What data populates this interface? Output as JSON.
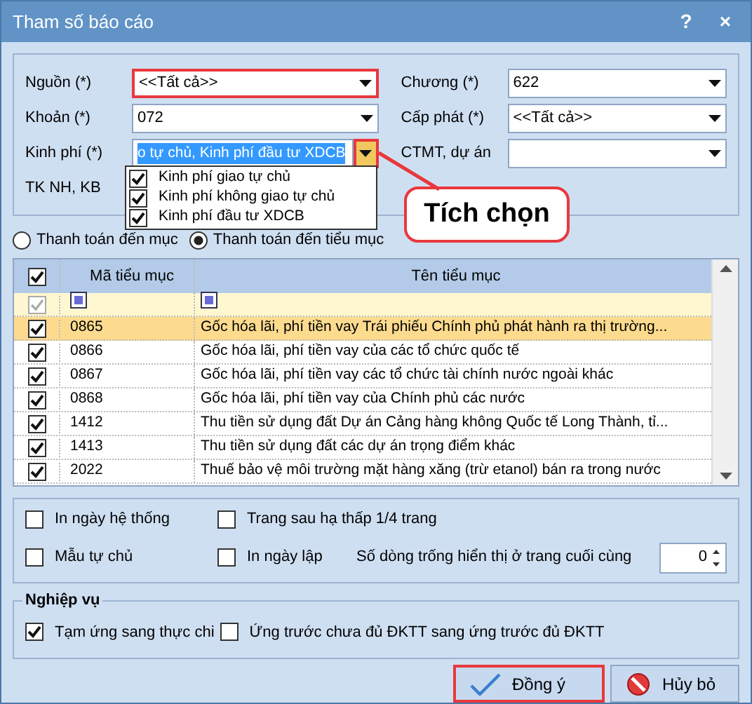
{
  "window": {
    "title": "Tham số báo cáo",
    "help": "?",
    "close": "×"
  },
  "fields": [
    {
      "label": "Nguồn (*)",
      "value": "<<Tất cả>>",
      "annotated": true
    },
    {
      "label": "Chương (*)",
      "value": "622",
      "annotated": false
    },
    {
      "label": "Khoản (*)",
      "value": "072",
      "annotated": false
    },
    {
      "label": "Cấp phát (*)",
      "value": "<<Tất cả>>",
      "annotated": false
    },
    {
      "label": "Kinh phí (*)",
      "value": "o tự chủ, Kinh phí đầu tư XDCB",
      "annotated": false,
      "text_selected": true,
      "dropdown_open": true
    },
    {
      "label": "CTMT, dự án",
      "annotated": false
    }
  ],
  "bank_label": "TK NH, KB",
  "dropdown": {
    "items": [
      {
        "label": "Kinh phí giao tự chủ",
        "checked": true
      },
      {
        "label": "Kinh phí không giao tự chủ",
        "checked": true
      },
      {
        "label": "Kinh phí đầu tư XDCB",
        "checked": true
      }
    ]
  },
  "callout": {
    "text": "Tích chọn"
  },
  "payment_radios": [
    {
      "label": "Thanh toán đến mục",
      "selected": false
    },
    {
      "label": "Thanh toán đến tiểu mục",
      "selected": true
    }
  ],
  "table": {
    "header_checked": true,
    "filter_checked": true,
    "columns": [
      "Mã tiểu mục",
      "Tên tiểu mục"
    ],
    "rows": [
      {
        "code": "0865",
        "name": "Gốc hóa lãi, phí tiền vay Trái phiếu Chính phủ phát hành ra thị trường...",
        "checked": true,
        "selected": true
      },
      {
        "code": "0866",
        "name": "Gốc hóa lãi, phí tiền vay của các tổ chức quốc tế",
        "checked": true,
        "selected": false
      },
      {
        "code": "0867",
        "name": "Gốc hóa lãi, phí tiền vay các tổ chức tài chính nước ngoài khác",
        "checked": true,
        "selected": false
      },
      {
        "code": "0868",
        "name": "Gốc hóa lãi, phí tiền vay của Chính phủ các nước",
        "checked": true,
        "selected": false
      },
      {
        "code": "1412",
        "name": "Thu tiền sử dụng đất Dự án Cảng hàng không Quốc tế Long Thành, tỉ...",
        "checked": true,
        "selected": false
      },
      {
        "code": "1413",
        "name": "Thu tiền sử dụng đất các dự án trọng điểm khác",
        "checked": true,
        "selected": false
      },
      {
        "code": "2022",
        "name": "Thuế bảo vệ môi trường mặt hàng xăng (trừ etanol) bán ra trong nước",
        "checked": true,
        "selected": false
      }
    ]
  },
  "options": [
    {
      "label": "In ngày hệ thống",
      "checked": false
    },
    {
      "label": "Trang sau hạ thấp 1/4 trang",
      "checked": false
    },
    {
      "label": "Mẫu tự chủ",
      "checked": false
    },
    {
      "label": "In ngày lập",
      "checked": false
    }
  ],
  "blank_lines": {
    "label": "Số dòng trống hiển thị ở trang cuối cùng",
    "value": "0"
  },
  "business": {
    "title": "Nghiệp vụ",
    "options": [
      {
        "label": "Tạm ứng sang thực chi",
        "checked": true
      },
      {
        "label": "Ứng trước chưa đủ ĐKTT sang ứng trước đủ ĐKTT",
        "checked": false
      }
    ]
  },
  "buttons": [
    {
      "label": "Đồng ý",
      "kind": "ok",
      "annotated": true
    },
    {
      "label": "Hủy bỏ",
      "kind": "cancel",
      "annotated": false
    }
  ]
}
